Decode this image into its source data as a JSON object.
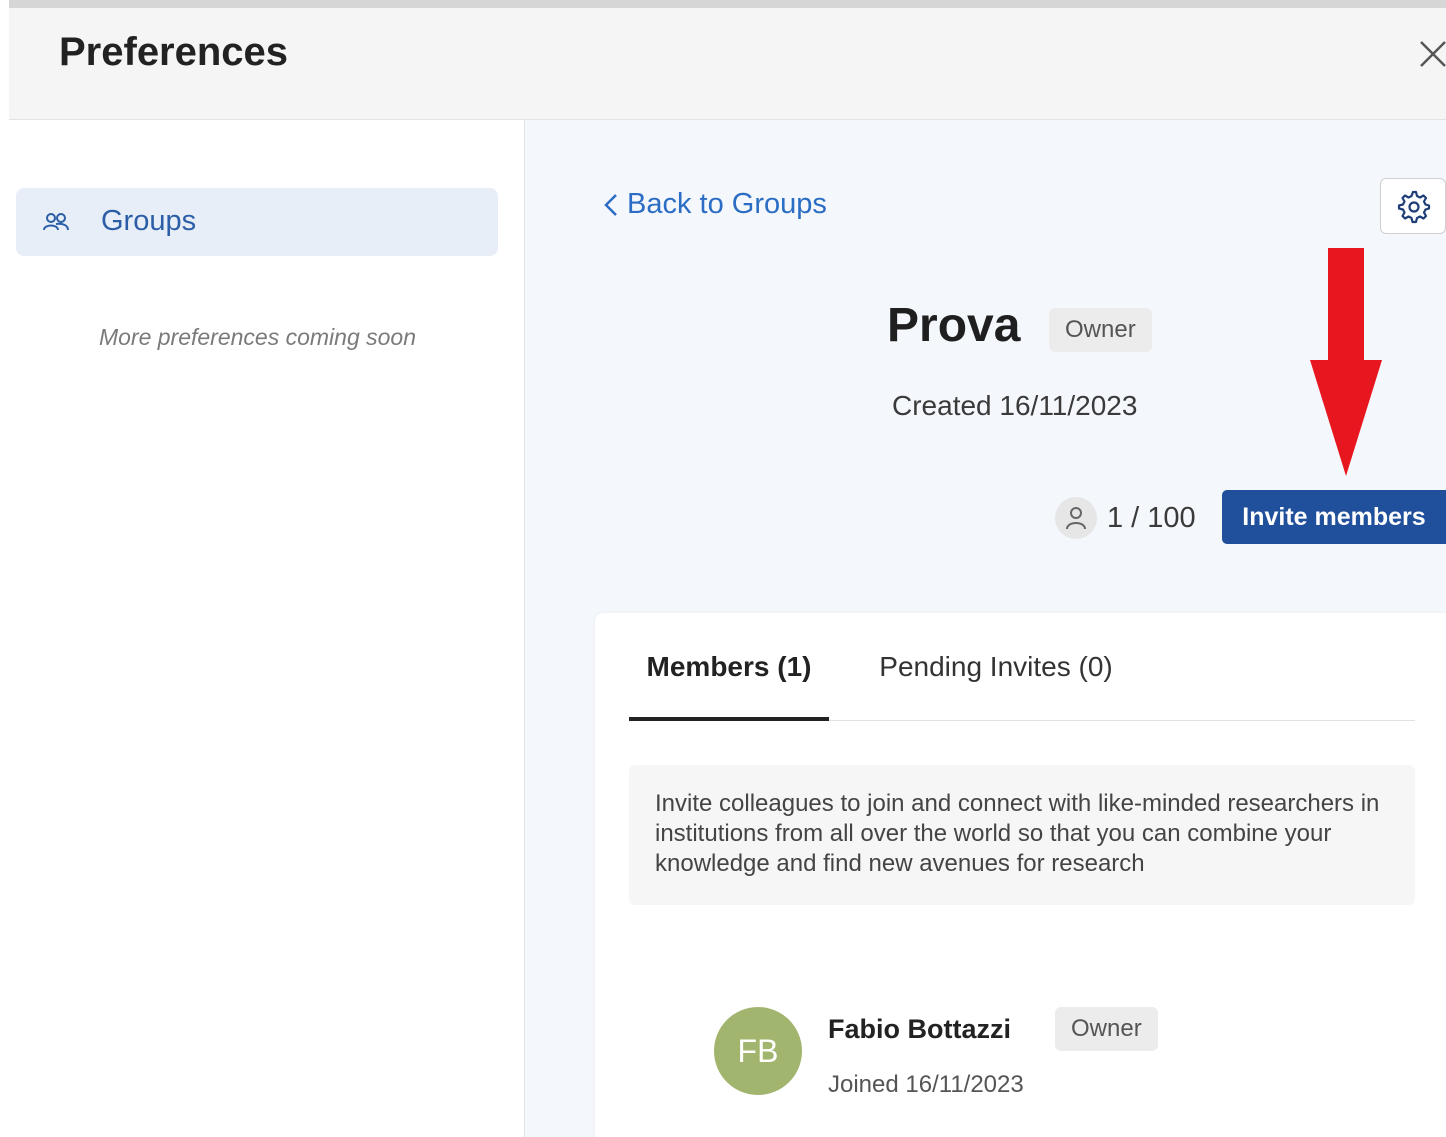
{
  "header": {
    "title": "Preferences",
    "close_icon": "close-icon"
  },
  "sidebar": {
    "items": [
      {
        "label": "Groups",
        "icon": "users-icon",
        "active": true
      }
    ],
    "note": "More preferences coming soon"
  },
  "main": {
    "back_label": "Back to Groups",
    "settings_icon": "gear-icon",
    "group": {
      "name": "Prova",
      "role": "Owner",
      "created": "Created 16/11/2023",
      "member_count": "1 / 100",
      "invite_label": "Invite members"
    },
    "annotation": {
      "arrow_color": "#e8161e",
      "direction": "down"
    },
    "tabs": [
      {
        "label": "Members (1)",
        "active": true
      },
      {
        "label": "Pending Invites (0)",
        "active": false
      }
    ],
    "info_text": "Invite colleagues to join and connect with like-minded researchers in institutions from all over the world so that you can combine your knowledge and find new avenues for research",
    "members": [
      {
        "initials": "FB",
        "name": "Fabio Bottazzi",
        "role": "Owner",
        "joined": "Joined 16/11/2023",
        "avatar_color": "#a2b56e"
      }
    ]
  },
  "colors": {
    "accent": "#204f9b",
    "link": "#2b6dc4",
    "sidebar_active_bg": "#e8eef7"
  }
}
